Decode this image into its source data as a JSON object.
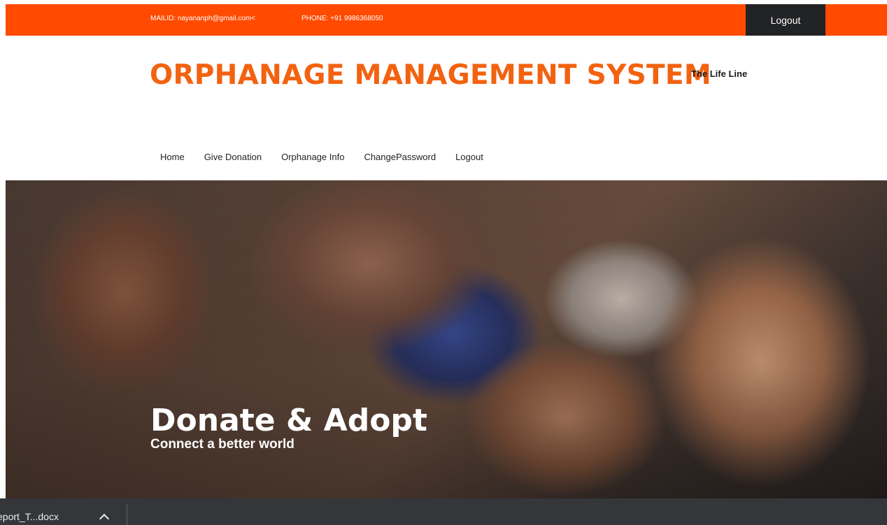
{
  "topbar": {
    "mail": "MAILID: nayananph@gmail.com<",
    "phone": "PHONE: +91 9986368050",
    "logout_label": "Logout"
  },
  "header": {
    "title": "ORPHANAGE MANAGEMENT SYSTEM",
    "tagline": "The Life Line"
  },
  "nav": {
    "items": [
      {
        "label": "Home"
      },
      {
        "label": "Give Donation"
      },
      {
        "label": "Orphanage Info"
      },
      {
        "label": "ChangePassword"
      },
      {
        "label": "Logout"
      }
    ]
  },
  "hero": {
    "headline": "Donate & Adopt",
    "subline": "Connect a better world"
  },
  "download_bar": {
    "item_label": "eport_T...docx"
  },
  "colors": {
    "accent": "#ff4a00",
    "title": "#f26210",
    "dark_button": "#222325",
    "download_bar": "#35363a"
  }
}
